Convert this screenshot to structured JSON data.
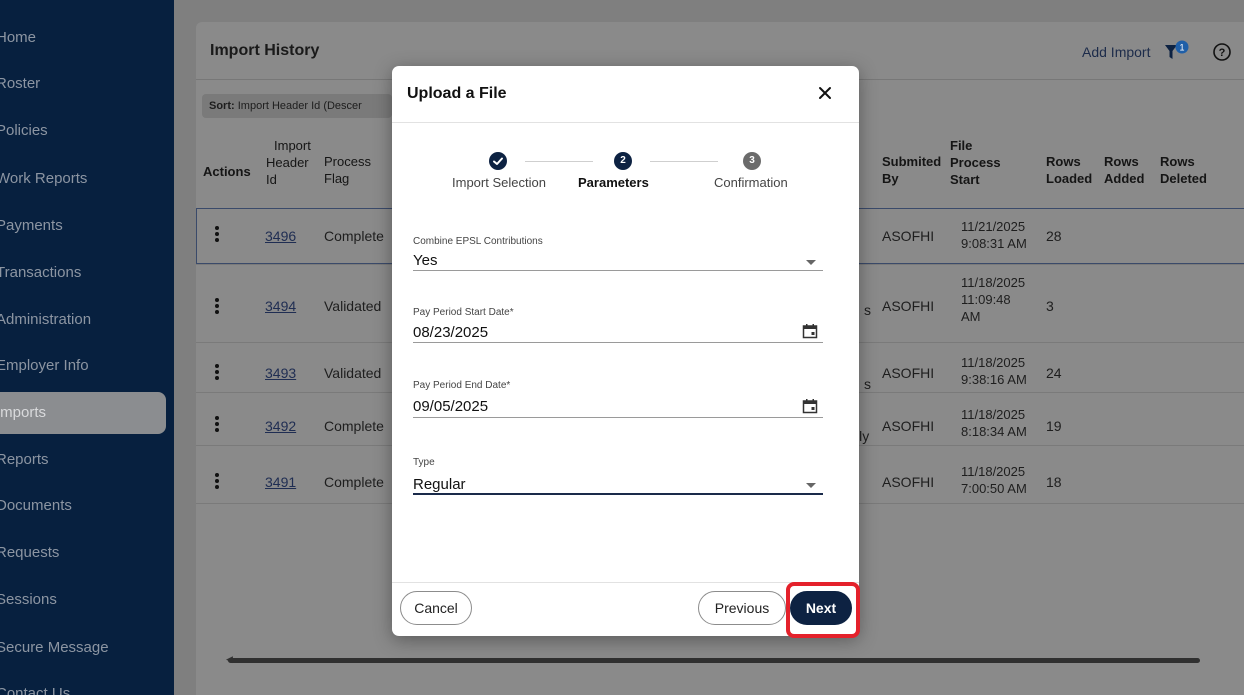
{
  "sidebar": {
    "items": [
      {
        "label": "Home"
      },
      {
        "label": "Roster"
      },
      {
        "label": "Policies"
      },
      {
        "label": "Work Reports"
      },
      {
        "label": "Payments"
      },
      {
        "label": "Transactions"
      },
      {
        "label": "Administration"
      },
      {
        "label": "Employer Info"
      },
      {
        "label": "Imports"
      },
      {
        "label": "Reports"
      },
      {
        "label": "Documents"
      },
      {
        "label": "Requests"
      },
      {
        "label": "Sessions"
      },
      {
        "label": "Secure Message"
      },
      {
        "label": "Contact Us"
      }
    ]
  },
  "page": {
    "title": "Import History",
    "add_import": "Add Import",
    "filter_badge": "1",
    "sort_label": "Sort:",
    "sort_value": "Import Header Id (Descer"
  },
  "table": {
    "headers": {
      "actions": "Actions",
      "import_header_id_1": "Import",
      "import_header_id_2": "Header",
      "import_header_id_3": "Id",
      "process_flag_1": "Process",
      "process_flag_2": "Flag",
      "submitted_by_1": "Submited",
      "submitted_by_2": "By",
      "file_process_start_1": "File",
      "file_process_start_2": "Process",
      "file_process_start_3": "Start",
      "rows_loaded_1": "Rows",
      "rows_loaded_2": "Loaded",
      "rows_added_1": "Rows",
      "rows_added_2": "Added",
      "rows_deleted_1": "Rows",
      "rows_deleted_2": "Deleted"
    },
    "rows": [
      {
        "id": "3496",
        "flag": "Complete",
        "partial": "",
        "by": "ASOFHI",
        "start_1": "11/21/2025",
        "start_2": "9:08:31 AM",
        "start_3": "",
        "loaded": "28"
      },
      {
        "id": "3494",
        "flag": "Validated",
        "partial": "s",
        "by": "ASOFHI",
        "start_1": "11/18/2025",
        "start_2": "11:09:48",
        "start_3": "AM",
        "loaded": "3"
      },
      {
        "id": "3493",
        "flag": "Validated",
        "partial": "s",
        "by": "ASOFHI",
        "start_1": "11/18/2025",
        "start_2": "9:38:16 AM",
        "start_3": "",
        "loaded": "24"
      },
      {
        "id": "3492",
        "flag": "Complete",
        "partial": "lly",
        "by": "ASOFHI",
        "start_1": "11/18/2025",
        "start_2": "8:18:34 AM",
        "start_3": "",
        "loaded": "19"
      },
      {
        "id": "3491",
        "flag": "Complete",
        "partial": "",
        "by": "ASOFHI",
        "start_1": "11/18/2025",
        "start_2": "7:00:50 AM",
        "start_3": "",
        "loaded": "18"
      }
    ]
  },
  "modal": {
    "title": "Upload a File",
    "steps": [
      {
        "number": "1",
        "label": "Import Selection",
        "state": "done"
      },
      {
        "number": "2",
        "label": "Parameters",
        "state": "current"
      },
      {
        "number": "3",
        "label": "Confirmation",
        "state": "todo"
      }
    ],
    "fields": {
      "combine_label": "Combine EPSL Contributions",
      "combine_value": "Yes",
      "start_label": "Pay Period Start Date*",
      "start_value": "08/23/2025",
      "end_label": "Pay Period End Date*",
      "end_value": "09/05/2025",
      "type_label": "Type",
      "type_value": "Regular"
    },
    "buttons": {
      "cancel": "Cancel",
      "previous": "Previous",
      "next": "Next"
    }
  },
  "colors": {
    "navy": "#0d2242",
    "highlight_red": "#e4212b"
  }
}
